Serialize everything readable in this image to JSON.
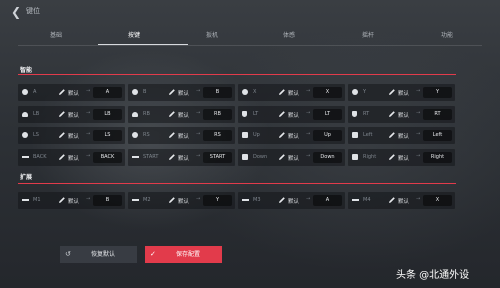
{
  "app": {
    "title": "键位"
  },
  "tabs": [
    "基础",
    "按键",
    "扳机",
    "体感",
    "摇杆",
    "功能"
  ],
  "sections": {
    "mapping": {
      "title": "智能",
      "rows": [
        [
          {
            "icon": "circle-icon",
            "name": "A",
            "default_label": "默认",
            "value": "A"
          },
          {
            "icon": "circle-icon",
            "name": "B",
            "default_label": "默认",
            "value": "B"
          },
          {
            "icon": "circle-icon",
            "name": "X",
            "default_label": "默认",
            "value": "X"
          },
          {
            "icon": "circle-icon",
            "name": "Y",
            "default_label": "默认",
            "value": "Y"
          }
        ],
        [
          {
            "icon": "bumper-icon",
            "name": "LB",
            "default_label": "默认",
            "value": "LB"
          },
          {
            "icon": "bumper-icon",
            "name": "RB",
            "default_label": "默认",
            "value": "RB"
          },
          {
            "icon": "trigger-icon",
            "name": "LT",
            "default_label": "默认",
            "value": "LT"
          },
          {
            "icon": "trigger-icon",
            "name": "RT",
            "default_label": "默认",
            "value": "RT"
          }
        ],
        [
          {
            "icon": "circle-icon",
            "name": "LS",
            "default_label": "默认",
            "value": "LS"
          },
          {
            "icon": "circle-icon",
            "name": "RS",
            "default_label": "默认",
            "value": "RS"
          },
          {
            "icon": "dpad-icon",
            "name": "Up",
            "default_label": "默认",
            "value": "Up"
          },
          {
            "icon": "dpad-icon",
            "name": "Left",
            "default_label": "默认",
            "value": "Left"
          }
        ],
        [
          {
            "icon": "back-button-icon",
            "name": "BACK",
            "default_label": "默认",
            "value": "BACK"
          },
          {
            "icon": "start-button-icon",
            "name": "START",
            "default_label": "默认",
            "value": "START"
          },
          {
            "icon": "dpad-icon",
            "name": "Down",
            "default_label": "默认",
            "value": "Down"
          },
          {
            "icon": "dpad-icon",
            "name": "Right",
            "default_label": "默认",
            "value": "Right"
          }
        ]
      ]
    },
    "extend": {
      "title": "扩展",
      "items": [
        {
          "icon": "back-paddle-icon",
          "name": "M1",
          "default_label": "默认",
          "value": "B"
        },
        {
          "icon": "back-paddle-icon",
          "name": "M2",
          "default_label": "默认",
          "value": "Y"
        },
        {
          "icon": "back-paddle-icon",
          "name": "M3",
          "default_label": "默认",
          "value": "A"
        },
        {
          "icon": "back-paddle-icon",
          "name": "M4",
          "default_label": "默认",
          "value": "X"
        }
      ]
    }
  },
  "buttons": {
    "restore": {
      "label": "恢复默认",
      "icon": "undo-icon"
    },
    "save": {
      "label": "保存配置",
      "icon": "check-icon"
    }
  },
  "watermark": "头条 @北通外设",
  "colors": {
    "accent": "#e23b4b"
  }
}
